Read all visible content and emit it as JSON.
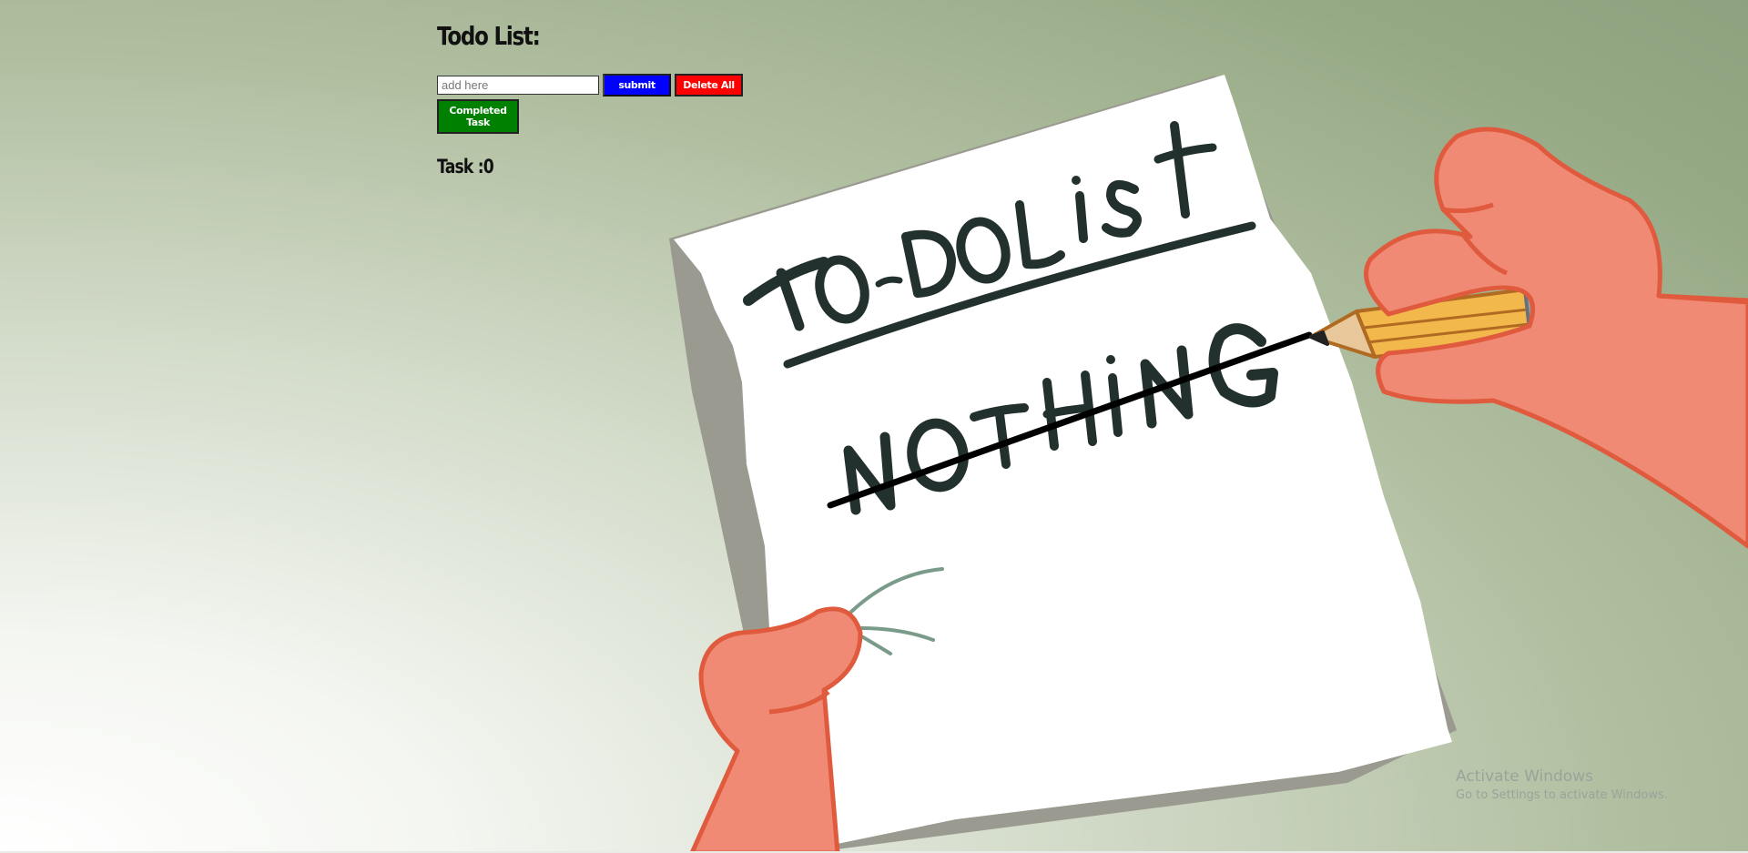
{
  "app": {
    "title": "Todo List:",
    "input": {
      "placeholder": "add here",
      "value": ""
    },
    "buttons": {
      "submit": "submit",
      "delete_all": "Delete All",
      "completed_task": "Completed Task"
    },
    "task_count_label": "Task :0"
  },
  "background_art": {
    "paper_heading": "TO-DOList",
    "paper_item": "NOTHING"
  },
  "watermark": {
    "title": "Activate Windows",
    "subtitle": "Go to Settings to activate Windows."
  },
  "colors": {
    "submit_button": "#0000ff",
    "delete_button": "#ff0000",
    "completed_button": "#008000",
    "skin": "#f08a75",
    "skin_outline": "#e05a3e",
    "paper": "#ffffff",
    "ink": "#22302e",
    "pencil": "#f2b84b"
  },
  "icons": {
    "background": "patrick-hand-todo-list-illustration"
  }
}
